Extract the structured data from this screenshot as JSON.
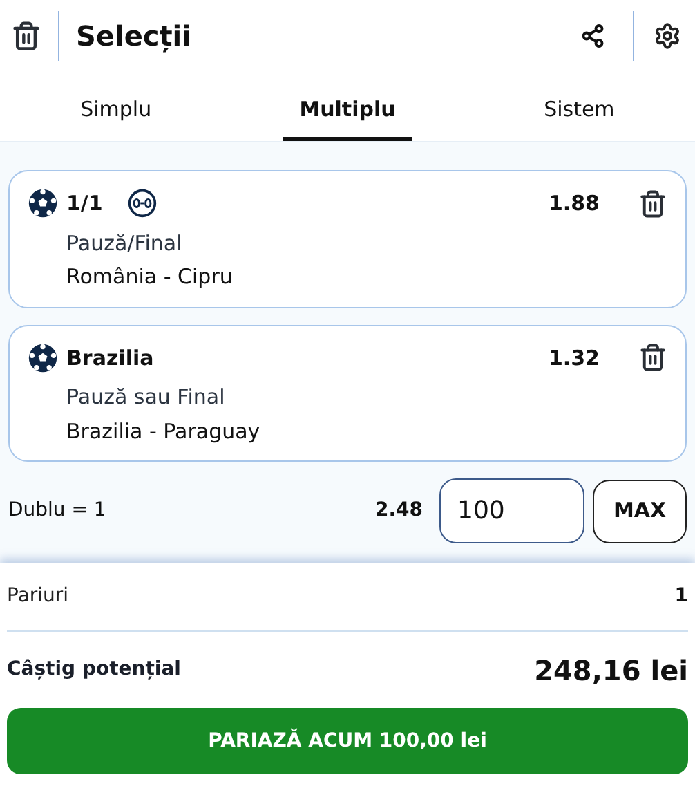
{
  "header": {
    "title": "Selecții"
  },
  "tabs": [
    {
      "label": "Simplu",
      "selected": false
    },
    {
      "label": "Multiplu",
      "selected": true
    },
    {
      "label": "Sistem",
      "selected": false
    }
  ],
  "selections": [
    {
      "pick": "1/1",
      "score_badge": true,
      "odds": "1.88",
      "market": "Pauză/Final",
      "event": "România - Cipru"
    },
    {
      "pick": "Brazilia",
      "score_badge": false,
      "odds": "1.32",
      "market": "Pauză sau Final",
      "event": "Brazilia - Paraguay"
    }
  ],
  "combo": {
    "label": "Dublu = 1",
    "odds": "2.48",
    "stake": "100",
    "max_button": "MAX"
  },
  "summary": {
    "bets_label": "Pariuri",
    "bets_value": "1",
    "win_label": "Câștig potențial",
    "win_value": "248,16 lei"
  },
  "place_button": "PARIAZĂ ACUM 100,00 lei"
}
